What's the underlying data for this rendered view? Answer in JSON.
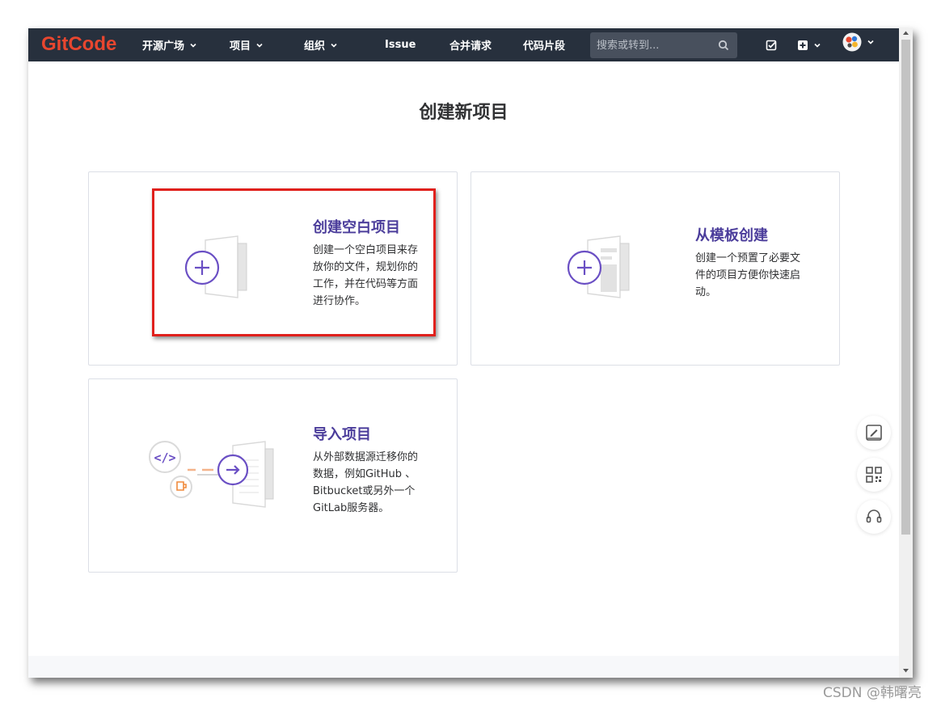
{
  "app": {
    "logo_text": "GitCode"
  },
  "nav": {
    "items": [
      {
        "label": "开源广场",
        "has_caret": true
      },
      {
        "label": "项目",
        "has_caret": true
      },
      {
        "label": "组织",
        "has_caret": true
      },
      {
        "label": "Issue",
        "has_caret": false
      },
      {
        "label": "合并请求",
        "has_caret": false
      },
      {
        "label": "代码片段",
        "has_caret": false
      }
    ],
    "search": {
      "placeholder": "搜索或转到..."
    },
    "icons": [
      "todo-icon",
      "create-new-icon",
      "avatar"
    ]
  },
  "page": {
    "title": "创建新项目"
  },
  "cards": [
    {
      "title": "创建空白项目",
      "description": "创建一个空白项目来存放你的文件，规划你的工作，并在代码等方面进行协作。",
      "icon": "blank-project-illustration",
      "highlighted": true
    },
    {
      "title": "从模板创建",
      "description": "创建一个预置了必要文件的项目方便你快速启动。",
      "icon": "template-project-illustration"
    },
    {
      "title": "导入项目",
      "description": "从外部数据源迁移你的数据，例如GitHub 、 Bitbucket或另外一个GitLab服务器。",
      "icon": "import-project-illustration"
    }
  ],
  "floating_tools": [
    "feedback-icon",
    "qrcode-icon",
    "support-headset-icon"
  ],
  "colors": {
    "navbar": "#27303d",
    "brand": "#e8462f",
    "accent": "#6a4fc4",
    "title": "#4b3d9b",
    "highlight": "#e0201c"
  },
  "watermark": "CSDN @韩曙亮"
}
